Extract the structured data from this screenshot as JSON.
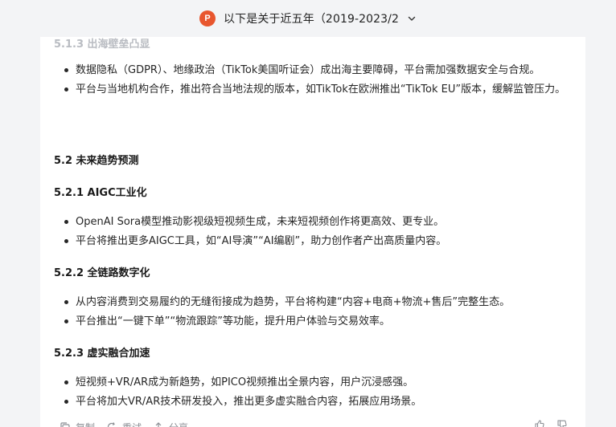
{
  "header": {
    "title": "以下是关于近五年（2019-2023/2",
    "file_icon": "powerpoint-icon",
    "file_icon_letter": "P",
    "dropdown_icon": "chevron-down-icon"
  },
  "content": {
    "faded_heading": "5.1.3 出海壁垒凸显",
    "section1_bullets": [
      "数据隐私（GDPR）、地缘政治（TikTok美国听证会）成出海主要障碍，平台需加强数据安全与合规。",
      "平台与当地机构合作，推出符合当地法规的版本，如TikTok在欧洲推出“TikTok EU”版本，缓解监管压力。"
    ],
    "heading_52": "5.2 未来趋势预测",
    "heading_521": "5.2.1 AIGC工业化",
    "section2_bullets": [
      "OpenAI Sora模型推动影视级短视频生成，未来短视频创作将更高效、更专业。",
      "平台将推出更多AIGC工具，如“AI导演”“AI编剧”，助力创作者产出高质量内容。"
    ],
    "heading_522": "5.2.2 全链路数字化",
    "section3_bullets": [
      "从内容消费到交易履约的无缝衔接成为趋势，平台将构建“内容+电商+物流+售后”完整生态。",
      "平台推出“一键下单”“物流跟踪”等功能，提升用户体验与交易效率。"
    ],
    "heading_523": "5.2.3 虚实融合加速",
    "section4_bullets": [
      "短视频+VR/AR成为新趋势，如PICO视频推出全景内容，用户沉浸感强。",
      "平台将加大VR/AR技术研发投入，推出更多虚实融合内容，拓展应用场景。"
    ]
  },
  "actions": {
    "copy_label": "复制",
    "regenerate_label": "重试",
    "share_label": "分享"
  },
  "colors": {
    "accent_ppt": "#e8562e",
    "background": "#f3f4f6",
    "card": "#ffffff"
  }
}
